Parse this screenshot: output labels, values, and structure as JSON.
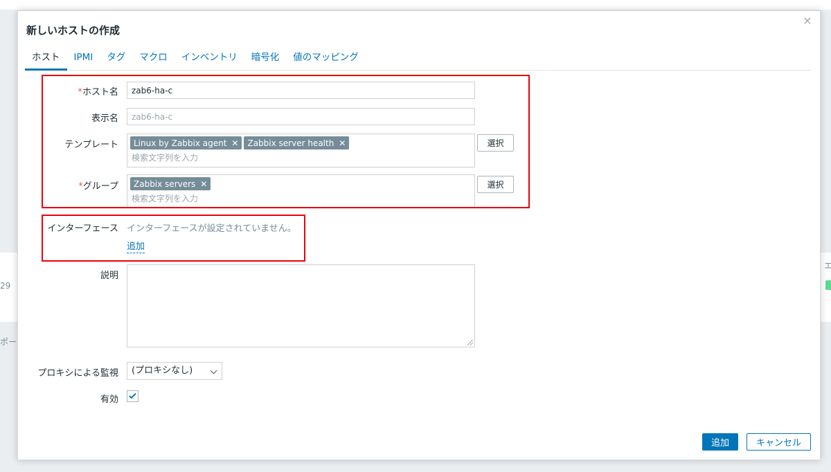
{
  "background": {
    "text_left_1": "29",
    "text_left_2": "ポー",
    "text_right_1": "エ"
  },
  "dialog": {
    "title": "新しいホストの作成",
    "close_label": "×"
  },
  "tabs": [
    {
      "label": "ホスト",
      "active": true
    },
    {
      "label": "IPMI"
    },
    {
      "label": "タグ"
    },
    {
      "label": "マクロ"
    },
    {
      "label": "インベントリ"
    },
    {
      "label": "暗号化"
    },
    {
      "label": "値のマッピング"
    }
  ],
  "form": {
    "required_mark": "*",
    "host_name": {
      "label": "ホスト名",
      "value": "zab6-ha-c"
    },
    "visible_name": {
      "label": "表示名",
      "placeholder": "zab6-ha-c"
    },
    "templates": {
      "label": "テンプレート",
      "chips": [
        "Linux by Zabbix agent",
        "Zabbix server health"
      ],
      "search_placeholder": "検索文字列を入力",
      "select_label": "選択"
    },
    "groups": {
      "label": "グループ",
      "chips": [
        "Zabbix servers"
      ],
      "search_placeholder": "検索文字列を入力",
      "select_label": "選択"
    },
    "interfaces": {
      "label": "インターフェース",
      "empty_text": "インターフェースが設定されていません。",
      "add_link": "追加"
    },
    "description": {
      "label": "説明"
    },
    "proxy": {
      "label": "プロキシによる監視",
      "value": "(プロキシなし)"
    },
    "enabled": {
      "label": "有効",
      "checked": true
    }
  },
  "footer": {
    "add_label": "追加",
    "cancel_label": "キャンセル"
  },
  "colors": {
    "accent": "#0275b8",
    "highlight_box": "#e8000d",
    "chip_bg": "#768d99"
  }
}
